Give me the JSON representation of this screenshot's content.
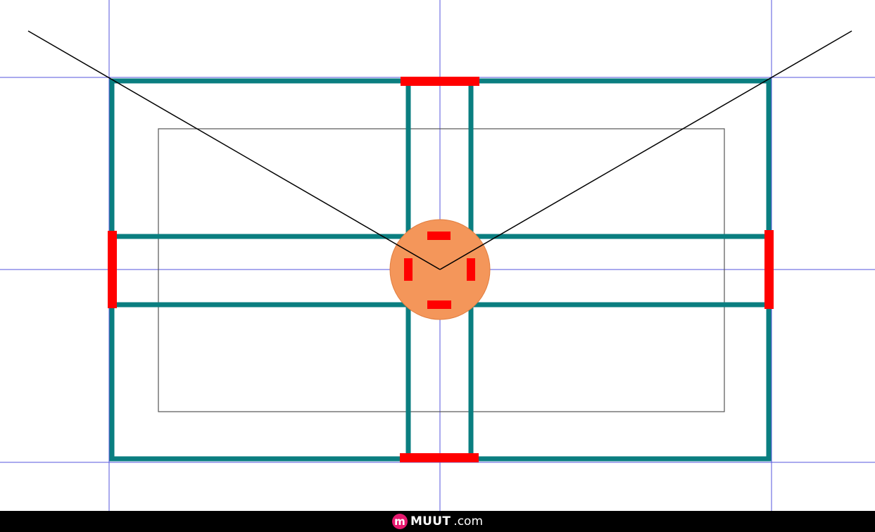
{
  "colors": {
    "guide": "#5555dd",
    "frame": "#0a7e80",
    "accent": "#ff0000",
    "hub": "#f4965a",
    "hub_stroke": "#e07d3f",
    "panel_stroke": "#555555",
    "ray": "#000000",
    "footer_bg": "#000000",
    "brand_mark": "#e5186e"
  },
  "footer": {
    "brand_mark": "m",
    "brand_name": "MUUT",
    "brand_tld": ".com"
  }
}
